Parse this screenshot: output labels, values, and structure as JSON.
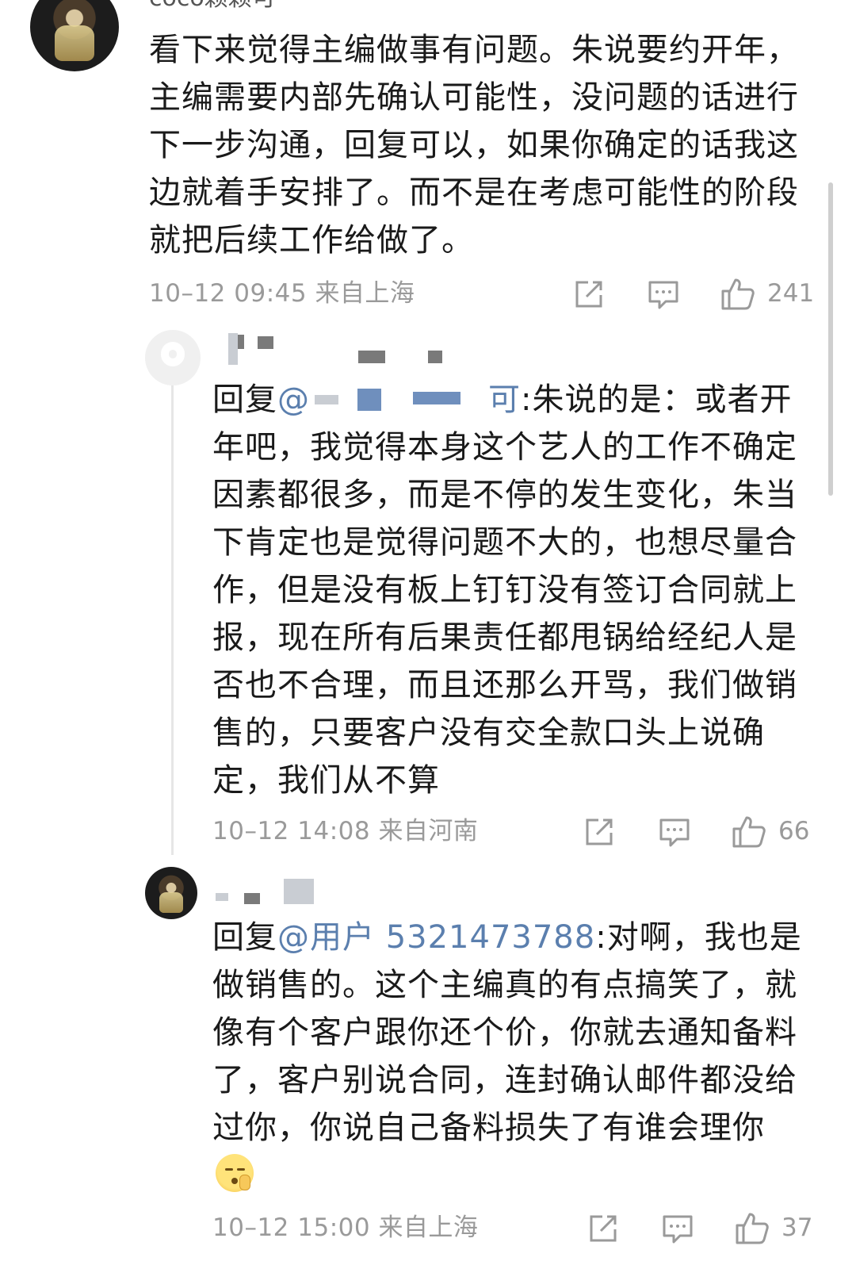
{
  "comment1": {
    "username": "coco颖颖可",
    "text": "看下来觉得主编做事有问题。朱说要约开年，主编需要内部先确认可能性，没问题的话进行下一步沟通，回复可以，如果你确定的话我这边就着手安排了。而不是在考虑可能性的阶段就把后续工作给做了。",
    "meta": "10–12 09:45  来自上海",
    "likes": "241",
    "avatar_icon": "user-avatar-icon"
  },
  "reply1": {
    "reply_prefix": "回复",
    "mention": "@",
    "mention_tail": "可",
    "text": ":朱说的是：或者开年吧，我觉得本身这个艺人的工作不确定因素都很多，而是不停的发生变化，朱当下肯定也是觉得问题不大的，也想尽量合作，但是没有板上钉钉没有签订合同就上报，现在所有后果责任都甩锅给经纪人是否也不合理，而且还那么开骂，我们做销售的，只要客户没有交全款口头上说确定，我们从不算",
    "meta": "10–12 14:08  来自河南",
    "likes": "66"
  },
  "reply2": {
    "reply_prefix": "回复",
    "mention": "@用户 5321473788",
    "text": ":对啊，我也是做销售的。这个主编真的有点搞笑了，就像有个客户跟你还个价，你就去通知备料了，客户别说合同，连封确认邮件都没给过你，你说自己备料损失了有谁会理你",
    "meta": "10–12 15:00  来自上海",
    "likes": "37"
  },
  "colors": {
    "text": "#1a1a1a",
    "meta": "#9a9a9a",
    "mention": "#5b7fae",
    "background": "#ffffff"
  },
  "icons": [
    "share-icon",
    "comment-icon",
    "like-icon",
    "shush-emoji"
  ]
}
